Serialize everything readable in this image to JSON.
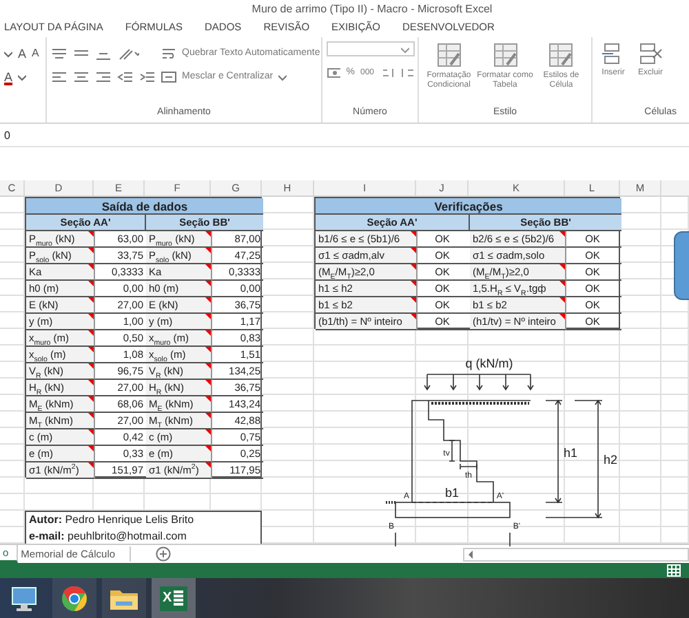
{
  "window": {
    "title": "Muro de arrimo (Tipo II) - Macro - Microsoft Excel"
  },
  "ribbon_tabs": [
    {
      "label": "LAYOUT DA PÁGINA",
      "selected": false
    },
    {
      "label": "FÓRMULAS",
      "selected": false
    },
    {
      "label": "DADOS",
      "selected": false
    },
    {
      "label": "REVISÃO",
      "selected": false
    },
    {
      "label": "EXIBIÇÃO",
      "selected": false
    },
    {
      "label": "DESENVOLVEDOR",
      "selected": false
    }
  ],
  "ribbon": {
    "font_buttons": [
      "A",
      "A",
      "A"
    ],
    "alignment": {
      "label": "Alinhamento",
      "wrap_text": "Quebrar Texto Automaticamente",
      "merge": "Mesclar e Centralizar"
    },
    "number": {
      "label": "Número",
      "percent": "%",
      "thousands": "000"
    },
    "styles": {
      "label": "Estilo",
      "buttons": [
        "Formatação\nCondicional",
        "Formatar como\nTabela",
        "Estilos de\nCélula"
      ]
    },
    "cells": {
      "label": "Células",
      "buttons": [
        "Inserir",
        "Excluir"
      ]
    }
  },
  "formula_bar": {
    "value": "0"
  },
  "columns": [
    "C",
    "D",
    "E",
    "F",
    "G",
    "H",
    "I",
    "J",
    "K",
    "L",
    "M"
  ],
  "output_table": {
    "title": "Saída de dados",
    "sections": [
      "Seção AA'",
      "Seção BB'"
    ],
    "rows": [
      {
        "label_aa": "P$_{muro}$ (kN)",
        "value_aa": "63,00",
        "comment_aa": true,
        "label_bb": "P$_{muro}$ (kN)",
        "value_bb": "87,00",
        "comment_bb": true
      },
      {
        "label_aa": "P$_{solo}$ (kN)",
        "value_aa": "33,75",
        "comment_aa": true,
        "label_bb": "P$_{solo}$ (kN)",
        "value_bb": "47,25",
        "comment_bb": true
      },
      {
        "label_aa": "Ka",
        "value_aa": "0,3333",
        "comment_aa": true,
        "label_bb": "Ka",
        "value_bb": "0,3333",
        "comment_bb": true
      },
      {
        "label_aa": "h0 (m)",
        "value_aa": "0,00",
        "comment_aa": true,
        "label_bb": "h0 (m)",
        "value_bb": "0,00",
        "comment_bb": true
      },
      {
        "label_aa": "E (kN)",
        "value_aa": "27,00",
        "comment_aa": true,
        "label_bb": "E (kN)",
        "value_bb": "36,75",
        "comment_bb": true
      },
      {
        "label_aa": "y (m)",
        "value_aa": "1,00",
        "comment_aa": true,
        "label_bb": "y (m)",
        "value_bb": "1,17",
        "comment_bb": true
      },
      {
        "label_aa": "x$_{muro}$ (m)",
        "value_aa": "0,50",
        "comment_aa": true,
        "label_bb": "x$_{muro}$ (m)",
        "value_bb": "0,83",
        "comment_bb": true
      },
      {
        "label_aa": "x$_{solo}$ (m)",
        "value_aa": "1,08",
        "comment_aa": true,
        "label_bb": "x$_{solo}$ (m)",
        "value_bb": "1,51",
        "comment_bb": true
      },
      {
        "label_aa": "V$_{R}$ (kN)",
        "value_aa": "96,75",
        "comment_aa": true,
        "label_bb": "V$_{R}$ (kN)",
        "value_bb": "134,25",
        "comment_bb": true
      },
      {
        "label_aa": "H$_{R}$ (kN)",
        "value_aa": "27,00",
        "comment_aa": true,
        "label_bb": "H$_{R}$ (kN)",
        "value_bb": "36,75",
        "comment_bb": true
      },
      {
        "label_aa": "M$_{E}$ (kNm)",
        "value_aa": "68,06",
        "comment_aa": true,
        "label_bb": "M$_{E}$ (kNm)",
        "value_bb": "143,24",
        "comment_bb": true
      },
      {
        "label_aa": "M$_{T}$ (kNm)",
        "value_aa": "27,00",
        "comment_aa": true,
        "label_bb": "M$_{T}$ (kNm)",
        "value_bb": "42,88",
        "comment_bb": true
      },
      {
        "label_aa": "c (m)",
        "value_aa": "0,42",
        "comment_aa": true,
        "label_bb": "c (m)",
        "value_bb": "0,75",
        "comment_bb": true
      },
      {
        "label_aa": "e (m)",
        "value_aa": "0,33",
        "comment_aa": true,
        "label_bb": "e (m)",
        "value_bb": "0,25",
        "comment_bb": true
      },
      {
        "label_aa": "σ1 (kN/m$^{2}$)",
        "value_aa": "151,97",
        "comment_aa": true,
        "label_bb": "σ1 (kN/m$^{2}$)",
        "value_bb": "117,95",
        "comment_bb": true
      }
    ]
  },
  "checks_table": {
    "title": "Verificações",
    "sections": [
      "Seção AA'",
      "Seção BB'"
    ],
    "rows": [
      {
        "label_aa": "b1/6 ≤ e ≤ (5b1)/6",
        "value_aa": "OK",
        "comment_aa": true,
        "label_bb": "b2/6 ≤ e ≤ (5b2)/6",
        "value_bb": "OK",
        "comment_bb": true
      },
      {
        "label_aa": "σ1 ≤ σadm,alv",
        "value_aa": "OK",
        "comment_aa": true,
        "label_bb": "σ1 ≤ σadm,solo",
        "value_bb": "OK",
        "comment_bb": false
      },
      {
        "label_aa": "(M$_{E}$/M$_{T}$)≥2,0",
        "value_aa": "OK",
        "comment_aa": true,
        "label_bb": "(M$_{E}$/M$_{T}$)≥2,0",
        "value_bb": "OK",
        "comment_bb": true
      },
      {
        "label_aa": "h1 ≤ h2",
        "value_aa": "OK",
        "comment_aa": true,
        "label_bb": "1,5.H$_{R}$ ≤ V$_{R}$.tgф",
        "value_bb": "OK",
        "comment_bb": true
      },
      {
        "label_aa": "b1 ≤ b2",
        "value_aa": "OK",
        "comment_aa": true,
        "label_bb": "b1 ≤ b2",
        "value_bb": "OK",
        "comment_bb": true
      },
      {
        "label_aa": "(b1/th) = Nº inteiro",
        "value_aa": "OK",
        "comment_aa": true,
        "label_bb": "(h1/tv) = Nº inteiro",
        "value_bb": "OK",
        "comment_bb": true
      }
    ]
  },
  "diagram": {
    "load": "q (kN/m)",
    "tv": "tv",
    "th": "th",
    "b1": "b1",
    "a": "A",
    "a_prime": "A'",
    "b": "B",
    "b_prime": "B'",
    "h1": "h1",
    "h2": "h2"
  },
  "author": {
    "name": "**Autor:** Pedro Henrique Lelis Brito",
    "email": "**e-mail:** peuhlbrito@hotmail.com"
  },
  "sheet_tabs": [
    {
      "label": "o",
      "selected": true
    },
    {
      "label": "Memorial de Cálculo",
      "selected": false
    }
  ],
  "taskbar": [
    {
      "kind": "computer",
      "active": false
    },
    {
      "kind": "chrome",
      "active": false
    },
    {
      "kind": "folder",
      "active": false
    },
    {
      "kind": "excel",
      "label": "X",
      "active": true
    }
  ]
}
